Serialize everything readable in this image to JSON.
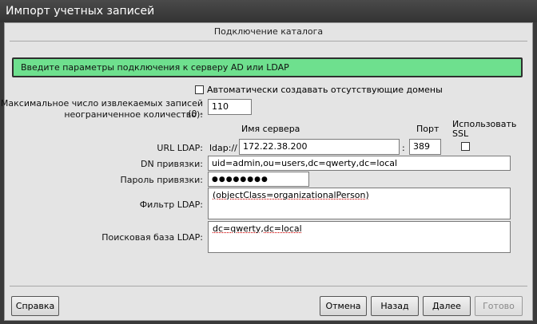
{
  "window": {
    "title": "Импорт учетных записей"
  },
  "section": {
    "title": "Подключение каталога"
  },
  "banner": {
    "text": "Введите параметры подключения к серверу AD или LDAP"
  },
  "auto_create": {
    "label": "Автоматически создавать отсутствующие домены",
    "checked": false
  },
  "max_records": {
    "label_line1": "Максимальное число извлекаемых записей (0 -",
    "label_line2": "неограниченное количество):",
    "value": "110"
  },
  "headers": {
    "server_name": "Имя сервера",
    "port": "Порт",
    "use_ssl_line1": "Использовать",
    "use_ssl_line2": "SSL"
  },
  "ldap_url": {
    "label": "URL LDAP:",
    "prefix": "ldap://",
    "server": "172.22.38.200",
    "separator": ":",
    "port": "389",
    "ssl_checked": false
  },
  "bind_dn": {
    "label": "DN привязки:",
    "value": "uid=admin,ou=users,dc=qwerty,dc=local"
  },
  "bind_password": {
    "label": "Пароль привязки:",
    "value": "●●●●●●●●"
  },
  "ldap_filter": {
    "label": "Фильтр LDAP:",
    "value": "(objectClass=organizationalPerson)"
  },
  "search_base": {
    "label": "Поисковая база LDAP:",
    "value": "dc=qwerty,dc=local"
  },
  "buttons": {
    "help": "Справка",
    "cancel": "Отмена",
    "back": "Назад",
    "next": "Далее",
    "finish": "Готово"
  }
}
